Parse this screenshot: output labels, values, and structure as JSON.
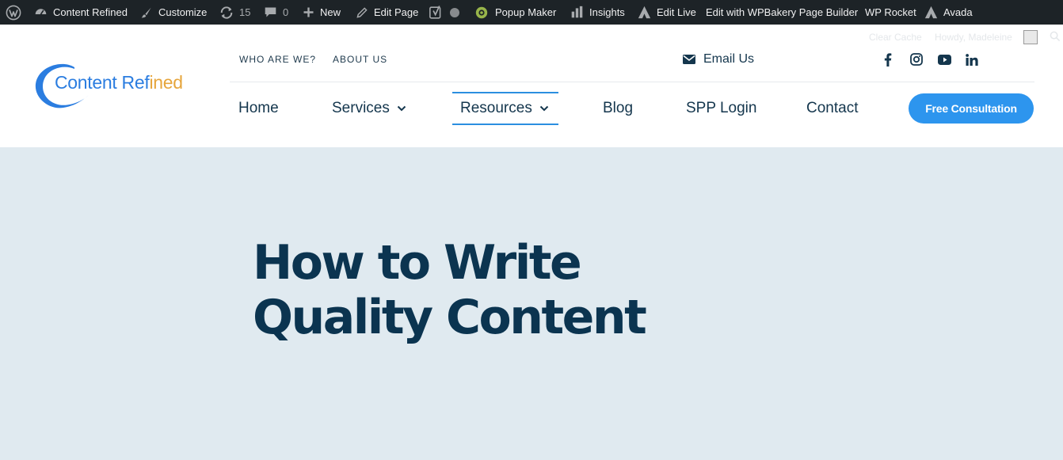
{
  "adminbar": {
    "site_name": "Content Refined",
    "customize": "Customize",
    "updates_count": "15",
    "comments_count": "0",
    "new": "New",
    "edit_page": "Edit Page",
    "popup_maker": "Popup Maker",
    "insights": "Insights",
    "edit_live": "Edit Live",
    "wpbakery": "Edit with WPBakery Page Builder",
    "wp_rocket": "WP Rocket",
    "avada": "Avada",
    "clear_cache": "Clear Cache",
    "howdy": "Howdy, Madeleine"
  },
  "logo": {
    "part1": "Content Ref",
    "part2": "ined"
  },
  "topnav": {
    "who": "WHO ARE WE?",
    "about": "ABOUT US",
    "email": "Email Us"
  },
  "social": [
    "facebook-icon",
    "instagram-icon",
    "youtube-icon",
    "linkedin-icon"
  ],
  "mainnav": {
    "home": "Home",
    "services": "Services",
    "resources": "Resources",
    "blog": "Blog",
    "spp_login": "SPP Login",
    "contact": "Contact",
    "cta": "Free Consultation"
  },
  "hero": {
    "title": "How to Write Quality Content"
  },
  "colors": {
    "adminbar_bg": "#1d2327",
    "nav_text": "#14364d",
    "accent": "#2d95ee",
    "hero_bg": "#e0eaf0",
    "hero_title": "#0b3450",
    "logo_blue": "#2b7de0",
    "logo_orange": "#e6a53c"
  }
}
